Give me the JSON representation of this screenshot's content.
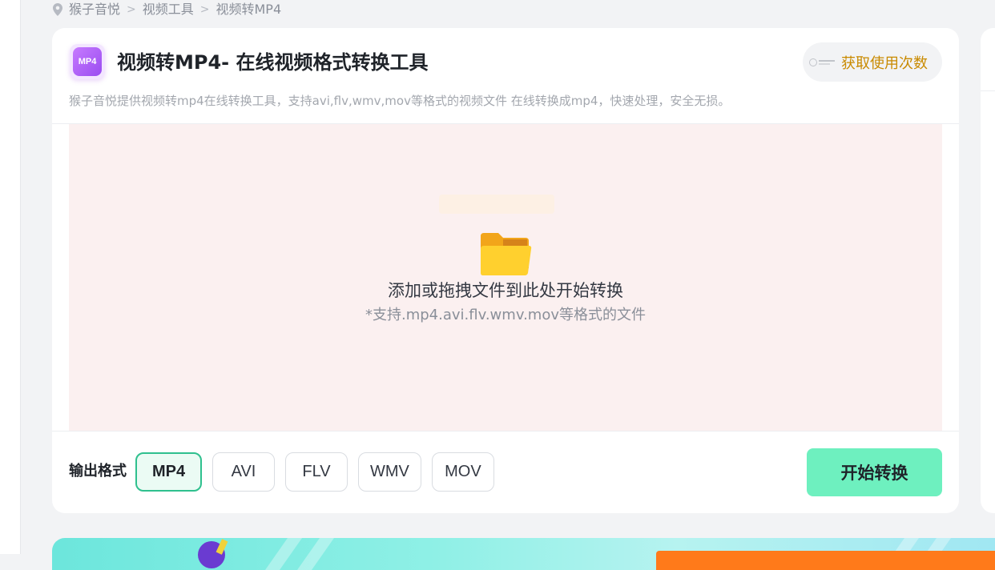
{
  "breadcrumb": {
    "items": [
      "猴子音悦",
      "视频工具",
      "视频转MP4"
    ],
    "separator": ">"
  },
  "header": {
    "logo_text": "MP4",
    "title": "视频转MP4- 在线视频格式转换工具",
    "quota_button_label": "获取使用次数",
    "subtitle": "猴子音悦提供视频转mp4在线转换工具，支持avi,flv,wmv,mov等格式的视频文件 在线转换成mp4，快速处理，安全无损。"
  },
  "drop_zone": {
    "title": "添加或拖拽文件到此处开始转换",
    "hint": "*支持.mp4.avi.flv.wmv.mov等格式的文件"
  },
  "output": {
    "label": "输出格式",
    "formats": [
      "MP4",
      "AVI",
      "FLV",
      "WMV",
      "MOV"
    ],
    "selected": "MP4",
    "start_button_label": "开始转换"
  },
  "colors": {
    "accent_green": "#2fc08e",
    "start_button_bg": "#6ef0bf",
    "quota_text": "#c98a00",
    "drop_zone_bg": "#fbf0f0"
  },
  "icons": {
    "breadcrumb": "location-pin-icon",
    "drop_zone": "folder-icon",
    "quota_logo": "brand-logo-icon"
  }
}
